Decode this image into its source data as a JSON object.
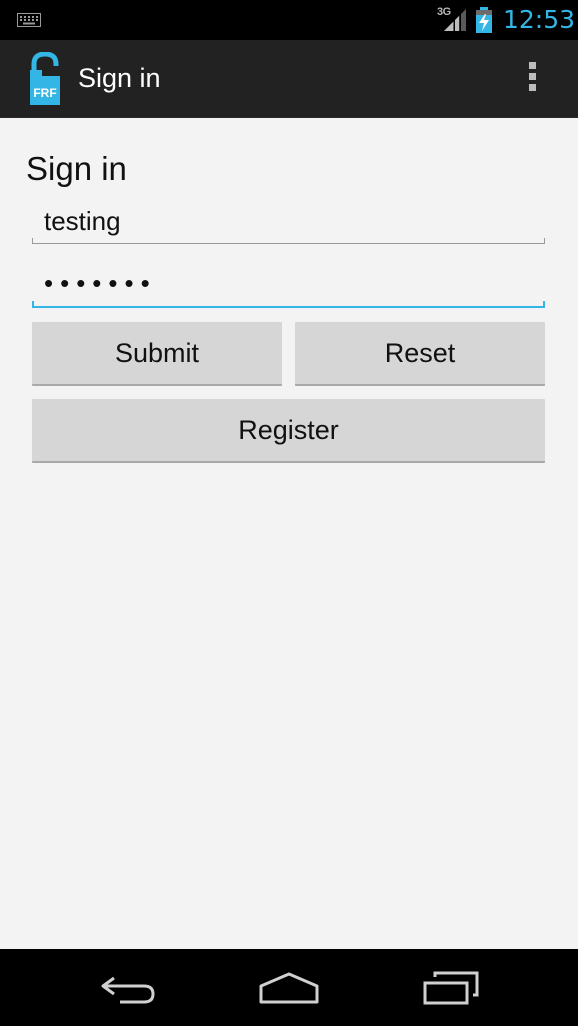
{
  "status_bar": {
    "network": "3G",
    "time": "12:53",
    "icons": [
      "keyboard-icon",
      "signal-icon",
      "battery-charging-icon"
    ]
  },
  "action_bar": {
    "logo_text": "FRF",
    "title": "Sign in",
    "menu_icon": "overflow-menu-icon"
  },
  "form": {
    "heading": "Sign in",
    "username_value": "testing",
    "password_value": "•••••••",
    "submit_label": "Submit",
    "reset_label": "Reset",
    "register_label": "Register"
  },
  "nav_bar": {
    "icons": [
      "back-icon",
      "home-icon",
      "recents-icon"
    ]
  },
  "colors": {
    "accent": "#33b5e5",
    "action_bar": "#222222",
    "background": "#f3f3f3",
    "button": "#d6d6d6"
  }
}
